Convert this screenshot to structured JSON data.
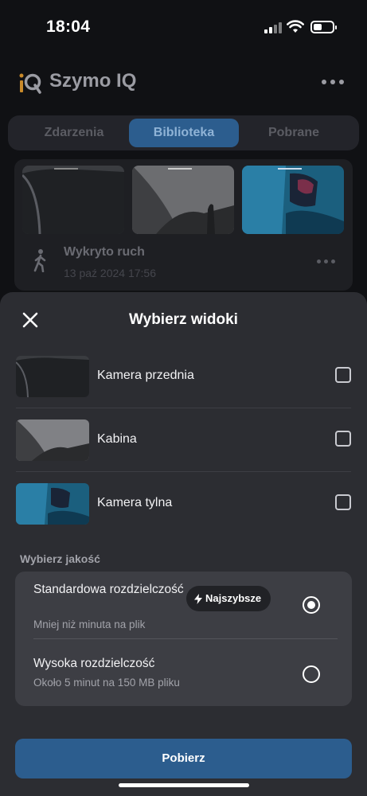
{
  "status_bar": {
    "time": "18:04"
  },
  "header": {
    "app_title": "Szymo IQ"
  },
  "tabs": [
    {
      "label": "Zdarzenia",
      "active": false
    },
    {
      "label": "Biblioteka",
      "active": true
    },
    {
      "label": "Pobrane",
      "active": false
    }
  ],
  "event_card": {
    "title": "Wykryto ruch",
    "timestamp": "13 paź 2024 17:56",
    "thumbnails": [
      "front-camera-thumb",
      "cabin-camera-thumb",
      "rear-camera-thumb"
    ]
  },
  "sheet": {
    "title": "Wybierz widoki",
    "views": [
      {
        "label": "Kamera przednia",
        "checked": false
      },
      {
        "label": "Kabina",
        "checked": false
      },
      {
        "label": "Kamera tylna",
        "checked": false
      }
    ],
    "quality_section_label": "Wybierz jakość",
    "quality_options": [
      {
        "title": "Standardowa rozdzielczość",
        "subtitle": "Mniej niż minuta na plik",
        "badge": "Najszybsze",
        "selected": true
      },
      {
        "title": "Wysoka rozdzielczość",
        "subtitle": "Około 5 minut na 150 MB pliku",
        "selected": false
      }
    ],
    "download_label": "Pobierz"
  },
  "colors": {
    "accent": "#2c5d8e",
    "sheet_bg": "#2c2d32",
    "option_bg": "#3d3e44"
  }
}
